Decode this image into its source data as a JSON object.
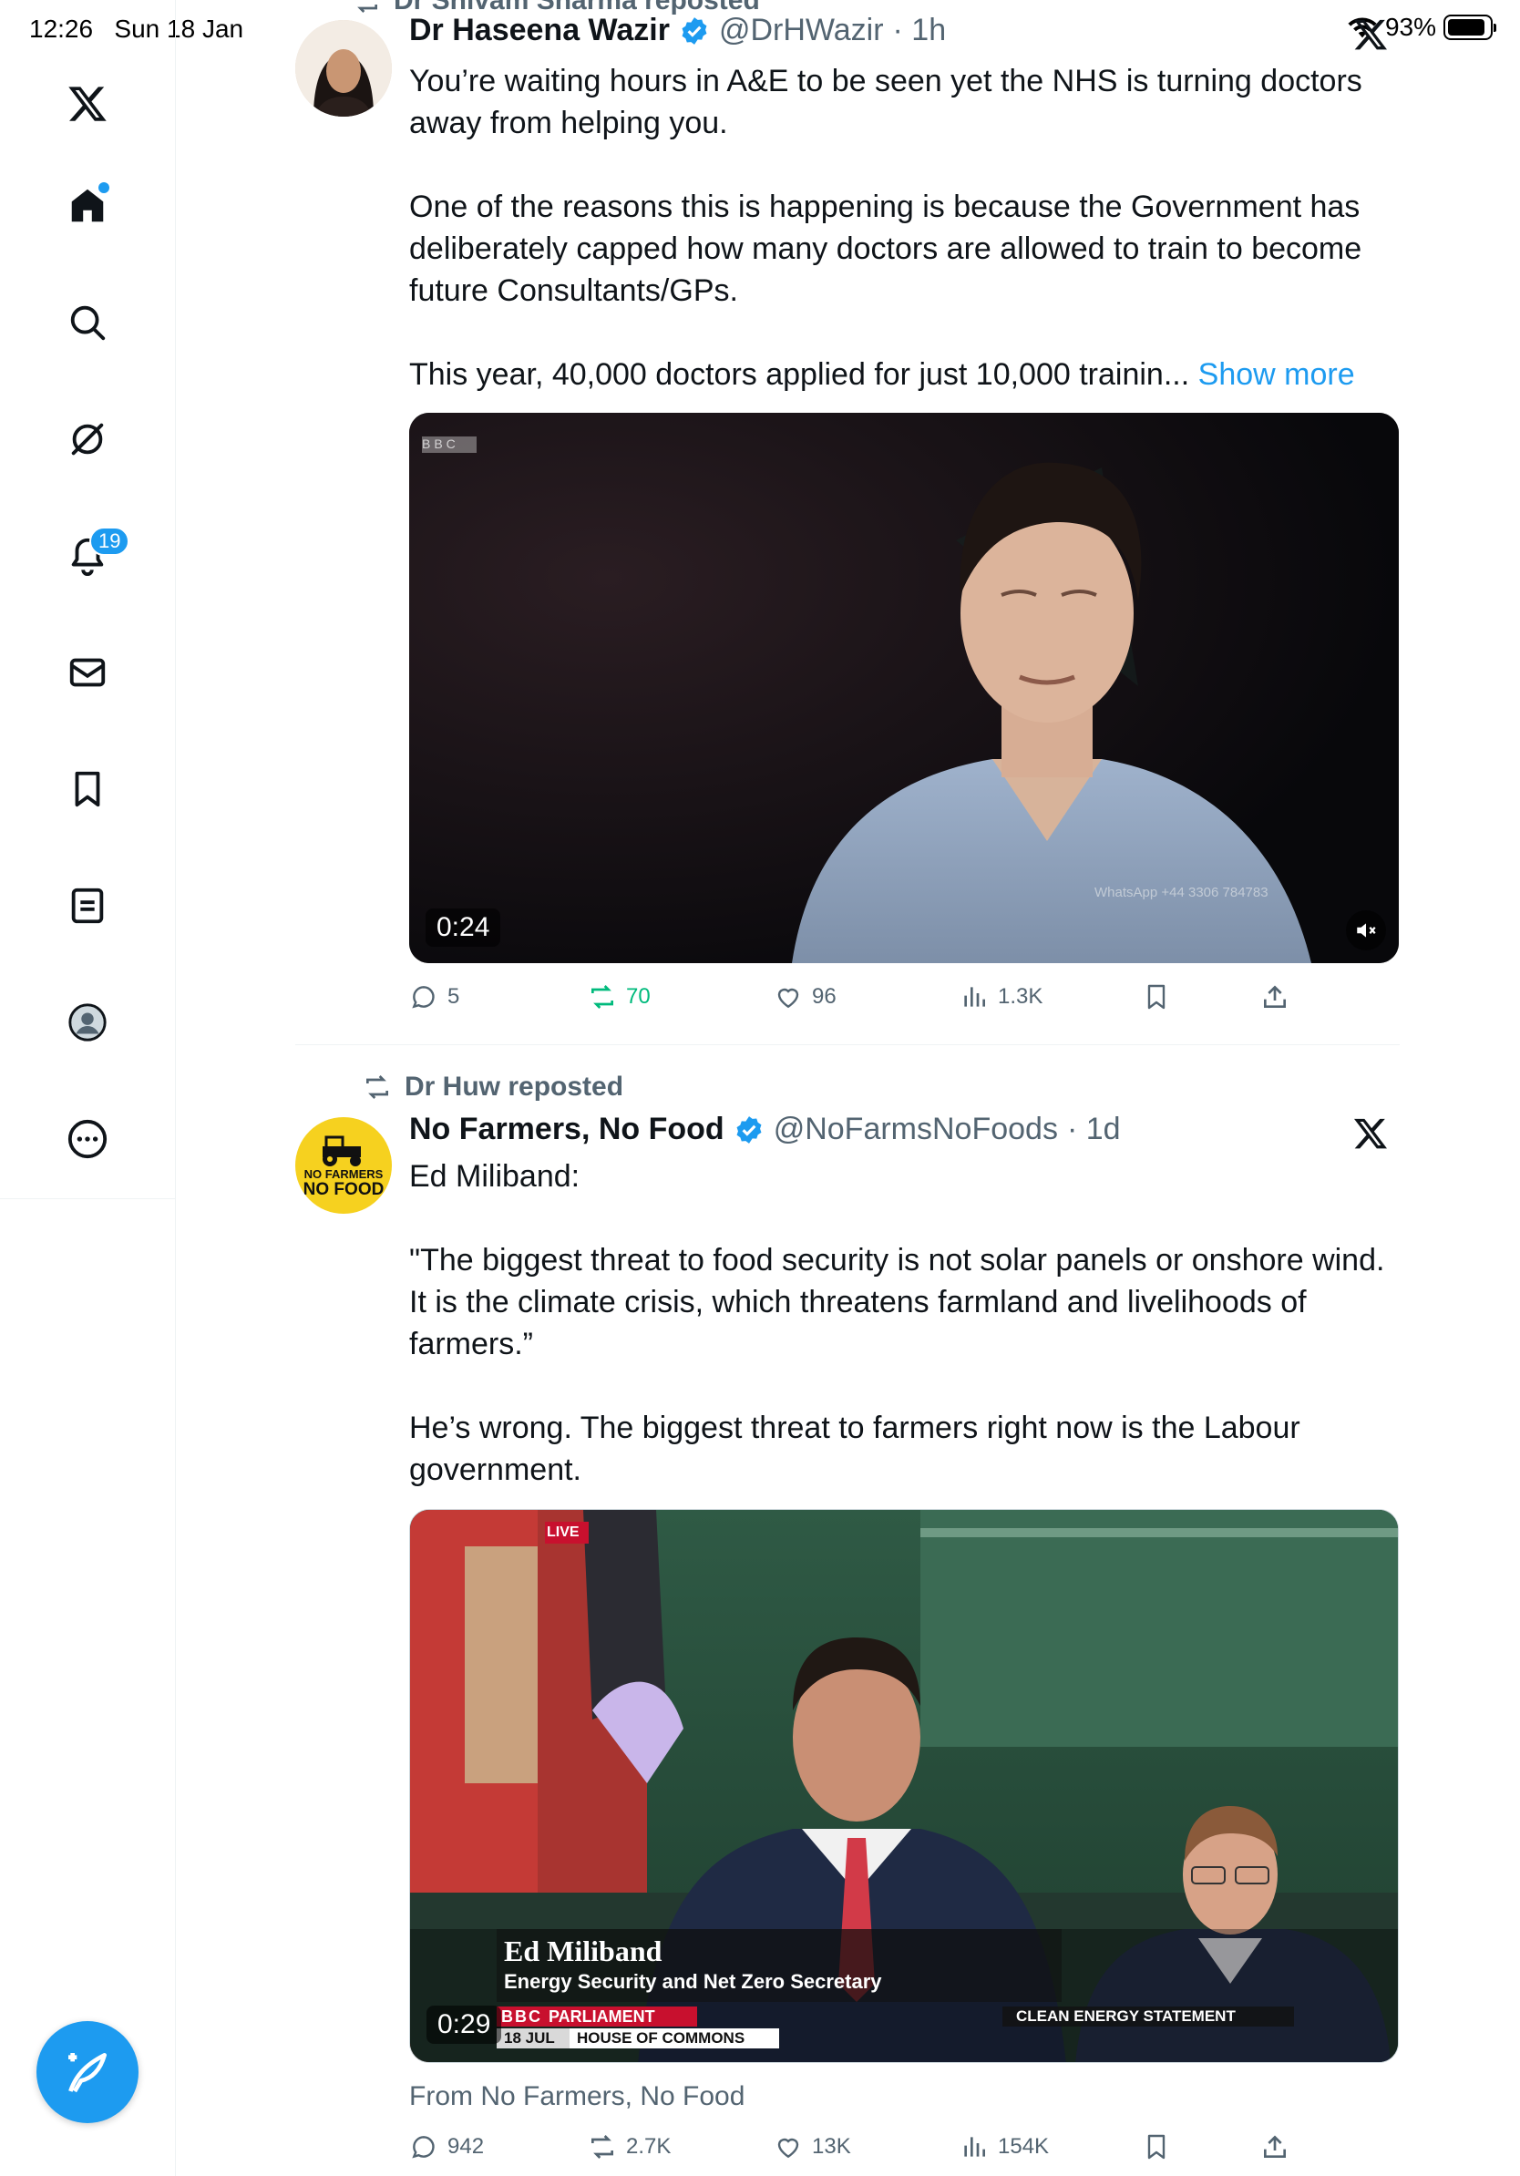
{
  "status": {
    "time": "12:26",
    "date": "Sun 18 Jan",
    "battery": "93%"
  },
  "sidebar": {
    "items": [
      {
        "icon": "x-logo"
      },
      {
        "icon": "home-icon"
      },
      {
        "icon": "search-icon"
      },
      {
        "icon": "grok-icon"
      },
      {
        "icon": "bell-icon",
        "badge": "19"
      },
      {
        "icon": "mail-icon"
      },
      {
        "icon": "bookmark-icon"
      },
      {
        "icon": "lists-icon"
      },
      {
        "icon": "profile-icon"
      },
      {
        "icon": "more-icon"
      }
    ],
    "compose": {
      "icon": "compose-icon"
    }
  },
  "tweets": [
    {
      "repost_label": "Dr Shivam Sharma reposted",
      "name": "Dr Haseena Wazir",
      "handle": "@DrHWazir",
      "time": "· 1h",
      "paragraphs": [
        "You’re waiting hours in A&E to be seen yet the NHS is turning doctors away from helping you.",
        "One of the reasons this is happening is because the Government has deliberately capped how many doctors are allowed to train to become future Consultants/GPs."
      ],
      "last_line": "This year, 40,000 doctors applied for just 10,000 trainin...",
      "show_more": "Show more",
      "video": {
        "duration": "0:24",
        "watermark_bbc": "BBC",
        "watermark_text": "WhatsApp +44 3306 784783"
      },
      "stats": {
        "replies": "5",
        "reposts": "70",
        "likes": "96",
        "views": "1.3K"
      }
    },
    {
      "repost_label": "Dr Huw reposted",
      "name": "No Farmers, No Food",
      "handle": "@NoFarmsNoFoods",
      "time": "· 1d",
      "avatar_text_top": "NO FARMERS",
      "avatar_text_bottom": "NO FOOD",
      "paragraphs": [
        "Ed Miliband:",
        "\"The biggest threat to food security is not solar panels or onshore wind. It is the climate crisis, which threatens farmland and livelihoods of farmers.”",
        "He’s wrong. The biggest threat to farmers right now is the Labour government."
      ],
      "video": {
        "duration": "0:29",
        "live": "LIVE",
        "caption_name": "Ed Miliband",
        "caption_role": "Energy Security and Net Zero Secretary",
        "channel": "PARLIAMENT",
        "bbc": "BBC",
        "date": "18 JUL",
        "place": "HOUSE OF COMMONS",
        "statement": "CLEAN ENERGY STATEMENT"
      },
      "from": "From No Farmers, No Food",
      "stats": {
        "replies": "942",
        "reposts": "2.7K",
        "likes": "13K",
        "views": "154K"
      }
    }
  ],
  "colors": {
    "accent": "#1d9bf0",
    "retweet_green": "#00ba7c",
    "muted": "#536471"
  }
}
